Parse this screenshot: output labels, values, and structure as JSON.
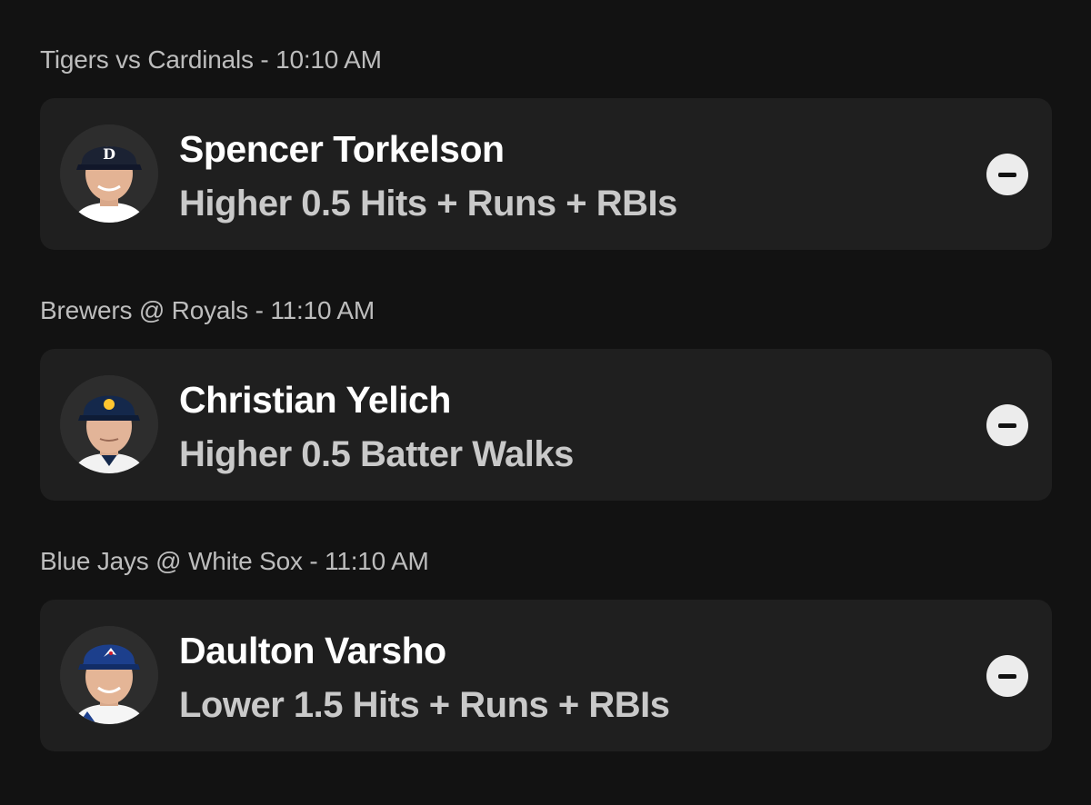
{
  "picks": [
    {
      "game": "Tigers vs Cardinals - 10:10 AM",
      "player": "Spencer Torkelson",
      "line": "Higher 0.5 Hits + Runs + RBIs",
      "cap_color": "#1b2233",
      "jersey_color": "#ffffff",
      "logo_icon": "tigers-d-logo-icon"
    },
    {
      "game": "Brewers @ Royals - 11:10 AM",
      "player": "Christian Yelich",
      "line": "Higher 0.5 Batter Walks",
      "cap_color": "#14284b",
      "jersey_color": "#f2f2f2",
      "logo_icon": "brewers-logo-icon"
    },
    {
      "game": "Blue Jays @ White Sox - 11:10 AM",
      "player": "Daulton Varsho",
      "line": "Lower 1.5 Hits + Runs + RBIs",
      "cap_color": "#1c3f8c",
      "jersey_color": "#f5f5f5",
      "logo_icon": "blue-jays-logo-icon"
    }
  ]
}
